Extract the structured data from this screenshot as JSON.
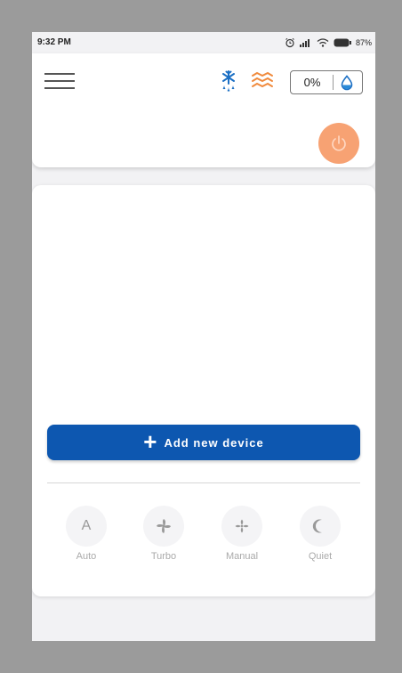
{
  "status_bar": {
    "time": "9:32 PM",
    "battery": "87%",
    "icons": [
      "alarm-icon",
      "signal-icon",
      "wifi-icon",
      "battery-icon"
    ]
  },
  "header": {
    "menu_icon": "hamburger-menu-icon",
    "mode_icons": [
      "snowflake-drop-icon",
      "heat-waves-icon"
    ],
    "humidity_value": "0%",
    "humidity_icon": "water-drop-icon",
    "power_icon": "power-icon"
  },
  "main": {
    "add_device_label": "Add new device",
    "add_device_icon": "plus-icon",
    "modes": [
      {
        "label": "Auto",
        "icon": "letter-a-icon",
        "letter": "A"
      },
      {
        "label": "Turbo",
        "icon": "fan-icon"
      },
      {
        "label": "Manual",
        "icon": "fan-manual-icon"
      },
      {
        "label": "Quiet",
        "icon": "moon-icon"
      }
    ]
  },
  "colors": {
    "accent_blue": "#0d57b0",
    "power_orange": "#f7a273",
    "heat_orange": "#f08a3c",
    "cool_blue": "#1b6fc4"
  }
}
